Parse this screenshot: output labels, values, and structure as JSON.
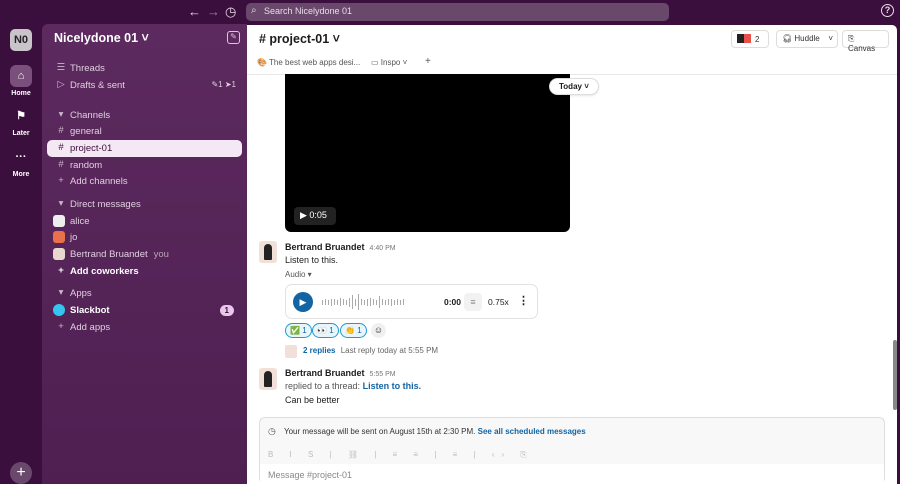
{
  "topbar": {
    "search_placeholder": "Search Nicelydone 01",
    "back": "←",
    "forward": "→",
    "history": "◷",
    "help": "?"
  },
  "rail": {
    "workspace": "N0",
    "items": [
      {
        "label": "Home",
        "icon": "⌂"
      },
      {
        "label": "Later",
        "icon": "⚑"
      },
      {
        "label": "More",
        "icon": "···"
      }
    ],
    "add": "+"
  },
  "sidebar": {
    "workspace_name": "Nicelydone 01 ˅",
    "threads": "Threads",
    "drafts": "Drafts & sent",
    "drafts_counts": "✎1  ➤1",
    "channels_header": "Channels",
    "channels": [
      "general",
      "project-01",
      "random"
    ],
    "add_channels": "Add channels",
    "dm_header": "Direct messages",
    "dms": [
      "alice",
      "jo",
      "Bertrand Bruandet"
    ],
    "you": "you",
    "add_coworkers": "Add coworkers",
    "apps_header": "Apps",
    "slackbot": "Slackbot",
    "slackbot_badge": "1",
    "add_apps": "Add apps"
  },
  "header": {
    "channel": "# project-01 ˅",
    "members": "2",
    "huddle": "Huddle",
    "canvas": "Canvas",
    "bookmark1": "The best web apps desi...",
    "bookmark2": "Inspo ˅",
    "add_bookmark": "+"
  },
  "video": {
    "duration": "0:05"
  },
  "today": "Today ˅",
  "messages": [
    {
      "author": "Bertrand Bruandet",
      "time": "4:40 PM",
      "text": "Listen to this.",
      "attachment_label": "Audio ▾",
      "audio_time": "0:00",
      "speed": "0.75x",
      "reactions": [
        {
          "emoji": "✅",
          "count": "1"
        },
        {
          "emoji": "👀",
          "count": "1"
        },
        {
          "emoji": "👏",
          "count": "1"
        }
      ],
      "replies": "2 replies",
      "last_reply": "Last reply today at 5:55 PM"
    },
    {
      "author": "Bertrand Bruandet",
      "time": "5:55 PM",
      "replied_prefix": "replied to a thread:",
      "replied_link": "Listen to this.",
      "text": "Can be better"
    }
  ],
  "composer": {
    "scheduled_text": "Your message will be sent on August 15th at 2:30 PM.",
    "scheduled_link": "See all scheduled messages",
    "toolbar": "B I S | ⛓ | ≡ ≡ | ≡ | ‹› ⎘",
    "placeholder": "Message #project-01"
  }
}
